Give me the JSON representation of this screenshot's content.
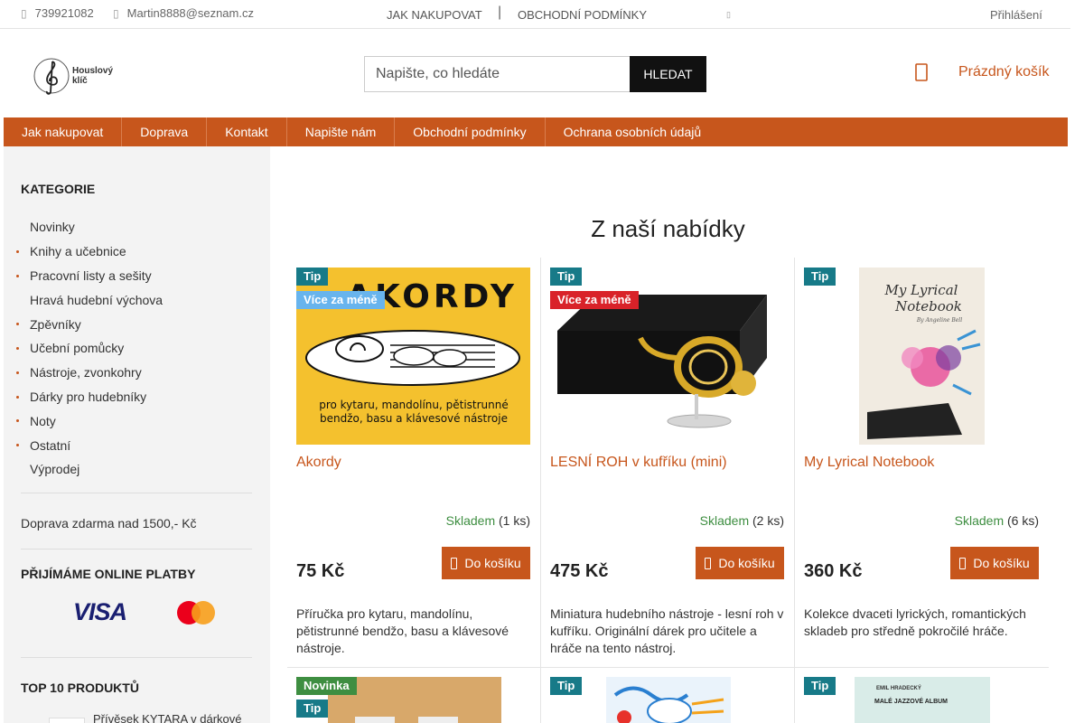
{
  "topbar": {
    "phone": "739921082",
    "email": "Martin8888@seznam.cz",
    "nav_how_to_buy": "JAK NAKUPOVAT",
    "nav_separator": "|",
    "nav_terms": "OBCHODNÍ PODMÍNKY",
    "login": "Přihlášení"
  },
  "header": {
    "logo_text_1": "Houslový",
    "logo_text_2": "klíč",
    "search_placeholder": "Napište, co hledáte",
    "search_button": "HLEDAT",
    "cart_label": "Prázdný košík"
  },
  "mainnav": {
    "items": [
      "Jak nakupovat",
      "Doprava",
      "Kontakt",
      "Napište nám",
      "Obchodní podmínky",
      "Ochrana osobních údajů"
    ]
  },
  "sidebar": {
    "categories_title": "KATEGORIE",
    "categories": [
      {
        "label": "Novinky",
        "bullet": false
      },
      {
        "label": "Knihy a učebnice",
        "bullet": true
      },
      {
        "label": "Pracovní listy a sešity",
        "bullet": true
      },
      {
        "label": "Hravá hudební výchova",
        "bullet": false
      },
      {
        "label": "Zpěvníky",
        "bullet": true
      },
      {
        "label": "Učební pomůcky",
        "bullet": true
      },
      {
        "label": "Nástroje, zvonkohry",
        "bullet": true
      },
      {
        "label": "Dárky pro hudebníky",
        "bullet": true
      },
      {
        "label": "Noty",
        "bullet": true
      },
      {
        "label": "Ostatní",
        "bullet": true
      },
      {
        "label": "Výprodej",
        "bullet": false
      }
    ],
    "free_shipping": "Doprava zdarma nad 1500,- Kč",
    "payments_title": "PŘIJÍMÁME ONLINE PLATBY",
    "visa_text": "VISA",
    "top10_title": "TOP 10 PRODUKTŮ",
    "top10_first": "Přívěsek KYTARA v dárkové"
  },
  "main": {
    "heading": "Z naší nabídky",
    "products": [
      {
        "flags": [
          "Tip",
          "Více za méně"
        ],
        "name": "Akordy",
        "stock_label": "Skladem",
        "stock_qty": "(1 ks)",
        "price": "75 Kč",
        "buy_label": "Do košíku",
        "description": "Příručka pro kytaru, mandolínu, pětistrunné bendžo, basu a klávesové nástroje.",
        "cover_title": "AKORDY",
        "cover_subtitle": "pro kytaru, mandolínu, pětistrunné bendžo, basu a klávesové nástroje"
      },
      {
        "flags": [
          "Tip",
          "Více za méně"
        ],
        "name": "LESNÍ ROH v kufříku (mini)",
        "stock_label": "Skladem",
        "stock_qty": "(2 ks)",
        "price": "475 Kč",
        "buy_label": "Do košíku",
        "description": "Miniatura hudebního nástroje - lesní roh v kufříku. Originální dárek pro učitele a hráče na tento nástroj."
      },
      {
        "flags": [
          "Tip"
        ],
        "name": "My Lyrical Notebook",
        "stock_label": "Skladem",
        "stock_qty": "(6 ks)",
        "price": "360 Kč",
        "buy_label": "Do košíku",
        "description": "Kolekce dvaceti lyrických, romantických skladeb pro středně pokročilé hráče.",
        "cover_title_1": "My Lyrical",
        "cover_title_2": "Notebook",
        "cover_author": "By Angeline Bell"
      }
    ],
    "row2_flags": [
      [
        "Novinka",
        "Tip"
      ],
      [
        "Tip"
      ],
      [
        "Tip"
      ]
    ],
    "row2_cover_text": "EMIL HRADECKÝ",
    "row2_cover_text2": "MALÉ JAZZOVÉ ALBUM"
  },
  "colors": {
    "accent": "#c7561c",
    "tip_flag": "#177a88",
    "less_flag_1": "#68b4ed",
    "less_flag_2": "#d92229",
    "new_flag": "#3e8e41",
    "in_stock": "#3e8e41"
  }
}
